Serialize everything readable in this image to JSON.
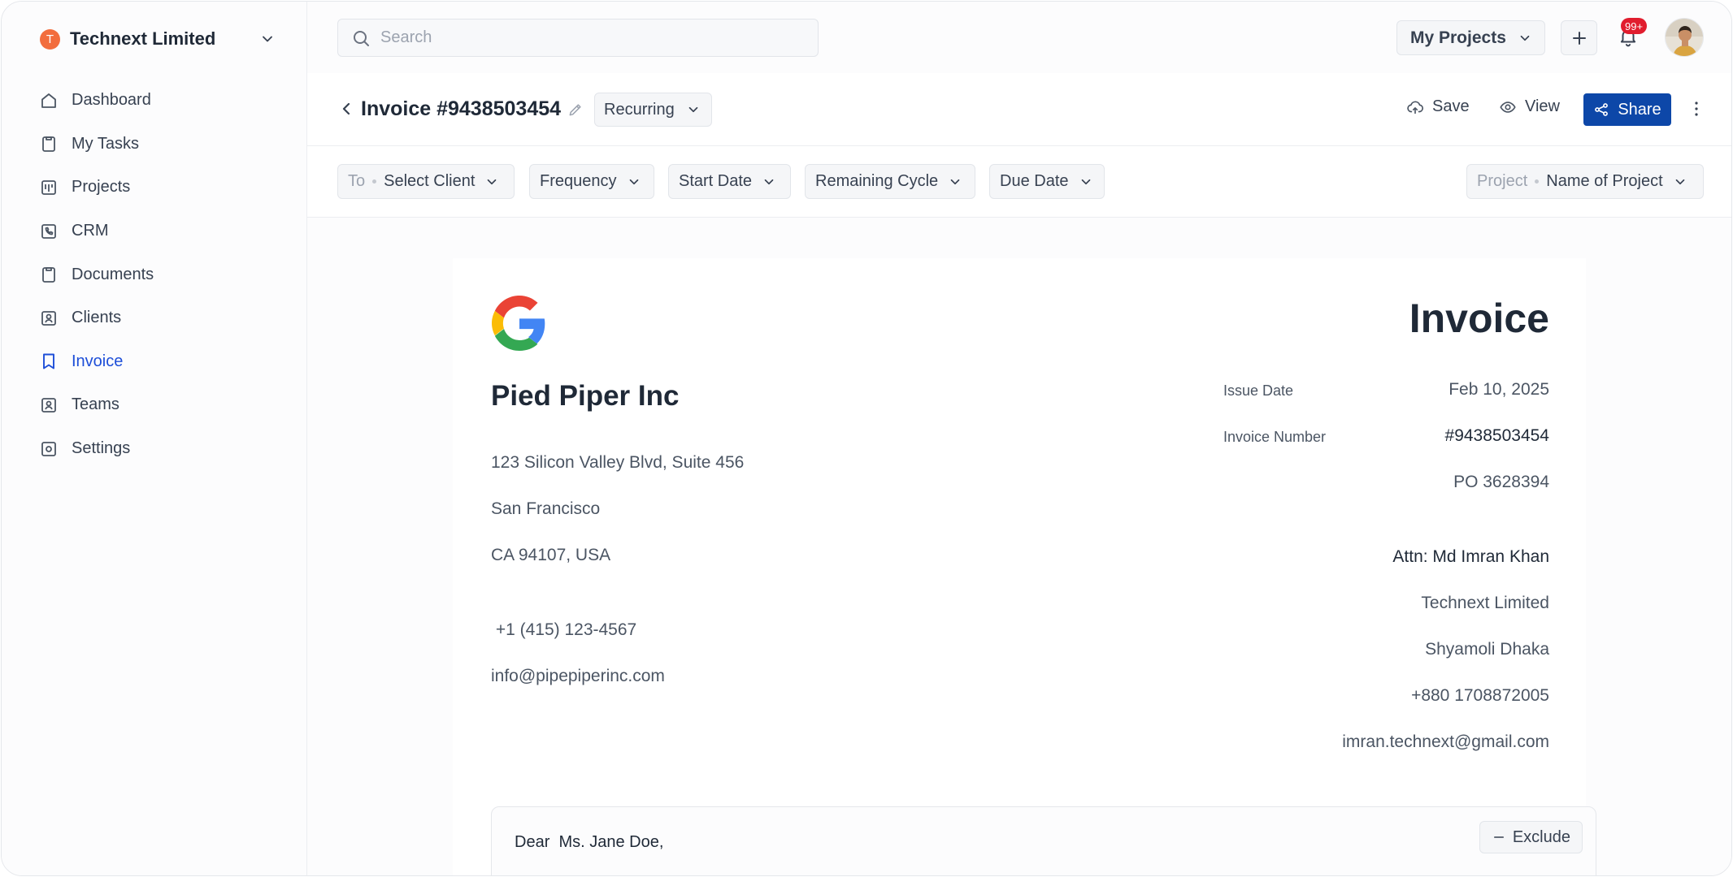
{
  "sidebar": {
    "org_initial": "T",
    "org_name": "Technext Limited",
    "items": [
      {
        "label": "Dashboard",
        "icon": "home-icon"
      },
      {
        "label": "My Tasks",
        "icon": "clipboard-icon"
      },
      {
        "label": "Projects",
        "icon": "kanban-icon"
      },
      {
        "label": "CRM",
        "icon": "phone-icon"
      },
      {
        "label": "Documents",
        "icon": "document-icon"
      },
      {
        "label": "Clients",
        "icon": "contact-icon"
      },
      {
        "label": "Invoice",
        "icon": "bookmark-icon",
        "active": true
      },
      {
        "label": "Teams",
        "icon": "team-icon"
      },
      {
        "label": "Settings",
        "icon": "settings-icon"
      }
    ]
  },
  "topbar": {
    "search_placeholder": "Search",
    "my_projects_label": "My Projects",
    "notification_badge": "99+"
  },
  "titlebar": {
    "title": "Invoice #9438503454",
    "recurring_label": "Recurring",
    "save_label": "Save",
    "view_label": "View",
    "share_label": "Share"
  },
  "filters": {
    "to_prefix": "To",
    "to_value": "Select Client",
    "frequency": "Frequency",
    "start_date": "Start Date",
    "remaining_cycle": "Remaining Cycle",
    "due_date": "Due Date",
    "project_prefix": "Project",
    "project_value": "Name of Project"
  },
  "invoice": {
    "heading": "Invoice",
    "from": {
      "company": "Pied Piper Inc",
      "address_line1": "123 Silicon Valley Blvd, Suite 456",
      "address_line2": "San Francisco",
      "address_line3": "CA 94107, USA",
      "phone": " +1 (415) 123-4567",
      "email": "info@pipepiperinc.com"
    },
    "issue_date_label": "Issue Date",
    "issue_date": "Feb 10, 2025",
    "invoice_number_label": "Invoice Number",
    "invoice_number": "#9438503454",
    "po": "PO 3628394",
    "to": {
      "attn": "Attn: Md Imran Khan",
      "company": "Technext Limited",
      "address": "Shyamoli Dhaka",
      "phone": "+880 1708872005",
      "email": "imran.technext@gmail.com"
    },
    "greeting": "Dear  Ms. Jane Doe,",
    "exclude_label": "Exclude"
  },
  "colors": {
    "accent": "#0d47a8",
    "active_nav": "#1d4ed8",
    "org_badge": "#f26d3d",
    "notification": "#e11d2e"
  }
}
